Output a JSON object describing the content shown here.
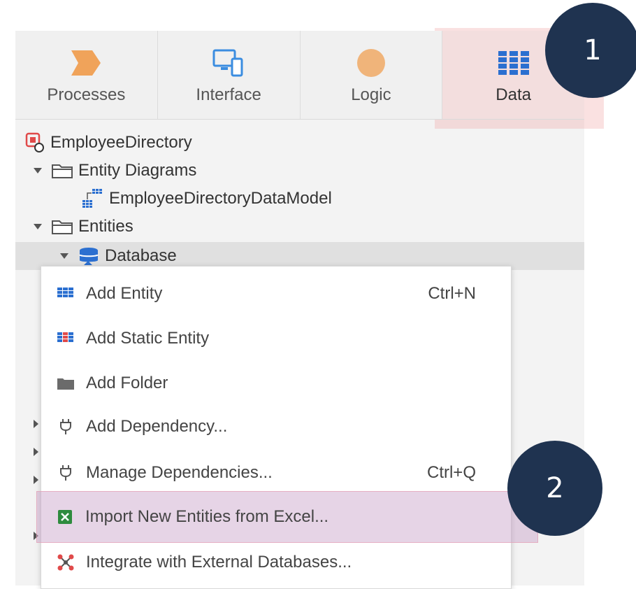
{
  "tabs": [
    {
      "label": "Processes",
      "icon": "processes-icon"
    },
    {
      "label": "Interface",
      "icon": "interface-icon"
    },
    {
      "label": "Logic",
      "icon": "logic-icon"
    },
    {
      "label": "Data",
      "icon": "data-icon"
    }
  ],
  "tree": {
    "module": "EmployeeDirectory",
    "entity_diagrams": "Entity Diagrams",
    "data_model": "EmployeeDirectoryDataModel",
    "entities": "Entities",
    "database": "Database"
  },
  "menu": {
    "items": [
      {
        "label": "Add Entity",
        "shortcut": "Ctrl+N",
        "icon": "entity-icon"
      },
      {
        "label": "Add Static Entity",
        "shortcut": "",
        "icon": "static-entity-icon"
      },
      {
        "label": "Add Folder",
        "shortcut": "",
        "icon": "folder-icon"
      },
      {
        "label": "Add Dependency...",
        "shortcut": "",
        "icon": "plug-icon"
      },
      {
        "label": "Manage Dependencies...",
        "shortcut": "Ctrl+Q",
        "icon": "plug-icon"
      },
      {
        "label": "Import New Entities from Excel...",
        "shortcut": "",
        "icon": "excel-icon"
      },
      {
        "label": "Integrate with External Databases...",
        "shortcut": "",
        "icon": "integration-icon"
      }
    ]
  },
  "callouts": {
    "one": "1",
    "two": "2"
  },
  "colors": {
    "accent_blue": "#2b6fd0",
    "callout": "#1f3350",
    "highlight_tab": "#f3dede",
    "highlight_item": "#dcc6dc",
    "processes_orange": "#f0a35a"
  }
}
